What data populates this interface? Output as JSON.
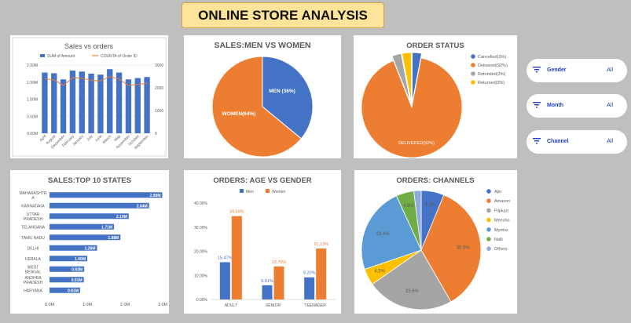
{
  "header": {
    "title": "ONLINE STORE ANALYSIS"
  },
  "slicers": [
    {
      "label": "Gender",
      "value": "All"
    },
    {
      "label": "Month",
      "value": "All"
    },
    {
      "label": "Channel",
      "value": "All"
    }
  ],
  "chart_data": [
    {
      "type": "bar",
      "title": "Sales vs orders",
      "legend": [
        "SUM of Amount",
        "COUNTA of Order ID"
      ],
      "categories": [
        "April",
        "August",
        "December",
        "February",
        "January",
        "July",
        "June",
        "March",
        "May",
        "November",
        "October",
        "September"
      ],
      "series": [
        {
          "name": "SUM of Amount",
          "type": "bar",
          "values": [
            1.78,
            1.76,
            1.58,
            1.84,
            1.81,
            1.75,
            1.72,
            1.88,
            1.78,
            1.58,
            1.62,
            1.65
          ]
        },
        {
          "name": "COUNTA of Order ID",
          "type": "line",
          "values": [
            2400,
            2350,
            2100,
            2450,
            2420,
            2330,
            2300,
            2500,
            2380,
            2100,
            2150,
            2200
          ]
        }
      ],
      "ylim": [
        0,
        2.0
      ],
      "yticks": [
        "0.00M",
        "0.50M",
        "1.00M",
        "1.50M",
        "2.00M"
      ],
      "y2lim": [
        0,
        3000
      ],
      "y2ticks": [
        "0",
        "1000",
        "2000",
        "3000"
      ]
    },
    {
      "type": "pie",
      "title": "SALES:MEN VS WOMEN",
      "slices": [
        {
          "label": "MEN (36%)",
          "value": 36,
          "color": "#4472c4"
        },
        {
          "label": "WOMEN(64%)",
          "value": 64,
          "color": "#ed7d31"
        }
      ]
    },
    {
      "type": "pie",
      "title": "ORDER STATUS",
      "legend_position": "right",
      "slices": [
        {
          "label": "Cancelled(3%)",
          "value": 3,
          "color": "#4472c4"
        },
        {
          "label": "Delivered(92%)",
          "value": 92,
          "color": "#ed7d31",
          "data_label": "DELIVERED(92%)"
        },
        {
          "label": "Refunded(3%)",
          "value": 3,
          "color": "#a5a5a5"
        },
        {
          "label": "Returned(3%)",
          "value": 3,
          "color": "#ffc000"
        }
      ]
    },
    {
      "type": "bar",
      "orientation": "horizontal",
      "title": "SALES:TOP 10 STATES",
      "categories": [
        "MAHARASHTRA",
        "KARNATAKA",
        "UTTAR PRADESH",
        "TELANGANA",
        "TAMIL NADU",
        "DELHI",
        "KERALA",
        "WEST BENGAL",
        "ANDHRA PRADESH",
        "HARYANA"
      ],
      "values": [
        2.99,
        2.64,
        2.1,
        1.71,
        1.88,
        1.26,
        1.0,
        0.92,
        0.91,
        0.81
      ],
      "data_labels": [
        "2.99M",
        "2.64M",
        "2.10M",
        "1.71M",
        "1.88M",
        "1.26M",
        "1.00M",
        "0.92M",
        "0.91M",
        "0.81M"
      ],
      "xlim": [
        0,
        3.0
      ],
      "xticks": [
        "0.0M",
        "1.0M",
        "2.0M",
        "3.0M"
      ]
    },
    {
      "type": "bar",
      "title": "ORDERS: AGE VS GENDER",
      "legend": [
        "Men",
        "Women"
      ],
      "categories": [
        "ADULT",
        "SENIOR",
        "TEENAGER"
      ],
      "series": [
        {
          "name": "Men",
          "values": [
            15.47,
            5.91,
            9.2
          ],
          "labels": [
            "15.47%",
            "5.91%",
            "9.20%"
          ],
          "color": "#4472c4"
        },
        {
          "name": "Women",
          "values": [
            34.59,
            13.7,
            21.13
          ],
          "labels": [
            "34.59%",
            "13.70%",
            "21.13%"
          ],
          "color": "#ed7d31"
        }
      ],
      "ylim": [
        0,
        40
      ],
      "yticks": [
        "0.00%",
        "10.00%",
        "20.00%",
        "30.00%",
        "40.00%"
      ]
    },
    {
      "type": "pie",
      "title": "ORDERS: CHANNELS",
      "legend_position": "right",
      "slices": [
        {
          "label": "Ajio",
          "value": 6.2,
          "data_label": "6.2%",
          "color": "#4472c4"
        },
        {
          "label": "Amazon",
          "value": 35.5,
          "data_label": "35.5%",
          "color": "#ed7d31"
        },
        {
          "label": "Flipkart",
          "value": 23.6,
          "data_label": "23.6%",
          "color": "#a5a5a5"
        },
        {
          "label": "Meesho",
          "value": 4.5,
          "data_label": "4.5%",
          "color": "#ffc000"
        },
        {
          "label": "Myntra",
          "value": 23.4,
          "data_label": "23.4%",
          "color": "#5b9bd5"
        },
        {
          "label": "Nalli",
          "value": 4.8,
          "data_label": "4.8%",
          "color": "#70ad47"
        },
        {
          "label": "Others",
          "value": 2.0,
          "data_label": "",
          "color": "#8faadc"
        }
      ]
    }
  ]
}
